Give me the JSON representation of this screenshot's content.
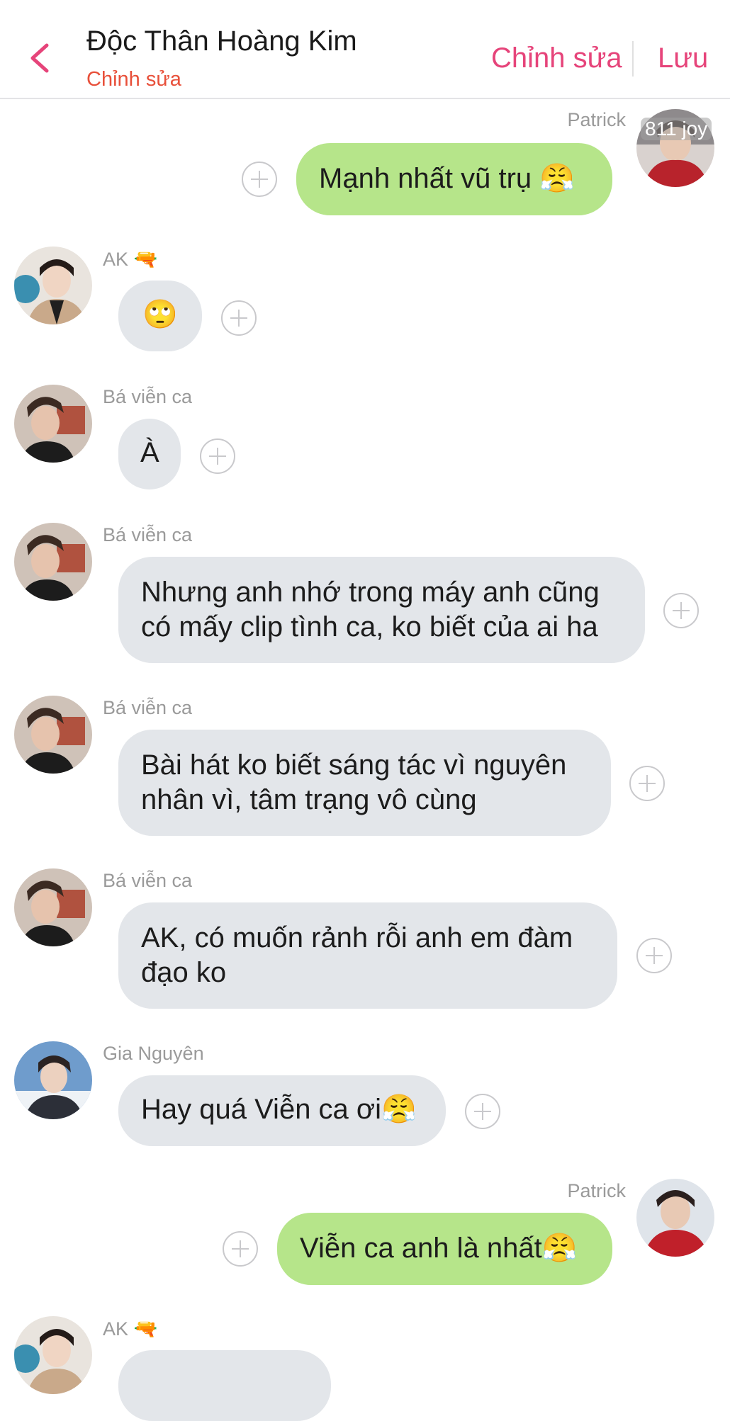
{
  "header": {
    "title": "Độc Thân Hoàng Kim",
    "subtitle": "Chỉnh sửa",
    "edit_label": "Chỉnh sửa",
    "save_label": "Lưu"
  },
  "messages": [
    {
      "sender": "Patrick",
      "text": "Mạnh nhất vũ trụ 😤",
      "tag": "811 joy"
    },
    {
      "sender": "AK 🔫",
      "text": "🙄"
    },
    {
      "sender": "Bá viễn ca",
      "text": "À"
    },
    {
      "sender": "Bá viễn ca",
      "text": "Nhưng anh nhớ trong máy anh cũng có mấy clip tình ca, ko biết của ai ha"
    },
    {
      "sender": "Bá viễn ca",
      "text": "Bài hát ko biết sáng tác vì nguyên nhân vì, tâm trạng vô cùng"
    },
    {
      "sender": "Bá viễn ca",
      "text": "AK, có muốn rảnh rỗi anh em đàm đạo ko"
    },
    {
      "sender": "Gia Nguyên",
      "text": "Hay quá Viễn ca ơi😤"
    },
    {
      "sender": "Patrick",
      "text": "Viễn ca anh là nhất😤"
    },
    {
      "sender": "AK 🔫"
    }
  ],
  "colors": {
    "accent": "#e6447a",
    "subtitle": "#e8503a",
    "bubble_in": "#e3e6ea",
    "bubble_out": "#b6e58a"
  }
}
